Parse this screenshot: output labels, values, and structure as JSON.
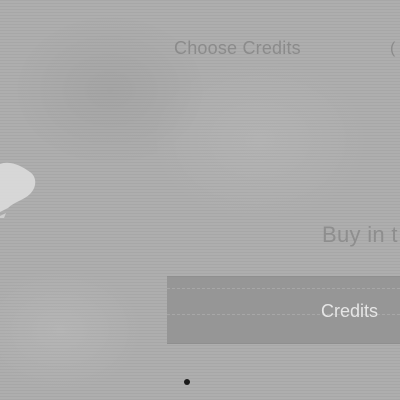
{
  "page": {
    "background_color": "#acacac"
  },
  "header": {
    "title": "Choose Credits",
    "partial_glyph": "("
  },
  "purchase": {
    "label": "Buy in t"
  },
  "credits_button": {
    "label": "Credits",
    "color": "#969696"
  },
  "decor": {
    "dot_icon": "dot-icon",
    "blob_icon": "white-blob-icon"
  }
}
